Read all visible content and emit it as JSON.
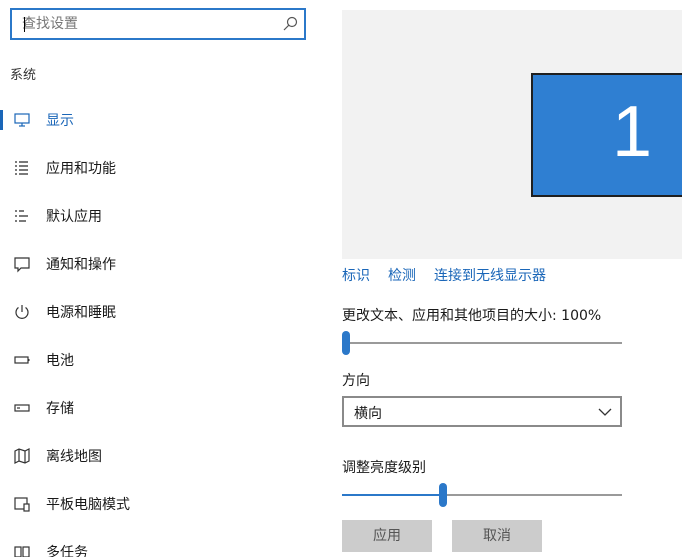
{
  "search": {
    "placeholder": "查找设置",
    "value": ""
  },
  "section": {
    "title": "系统"
  },
  "sidebar": {
    "items": [
      {
        "label": "显示",
        "icon": "monitor-icon",
        "active": true
      },
      {
        "label": "应用和功能",
        "icon": "list-icon"
      },
      {
        "label": "默认应用",
        "icon": "default-apps-icon"
      },
      {
        "label": "通知和操作",
        "icon": "message-icon"
      },
      {
        "label": "电源和睡眠",
        "icon": "power-icon"
      },
      {
        "label": "电池",
        "icon": "battery-icon"
      },
      {
        "label": "存储",
        "icon": "storage-icon"
      },
      {
        "label": "离线地图",
        "icon": "map-icon"
      },
      {
        "label": "平板电脑模式",
        "icon": "tablet-icon"
      },
      {
        "label": "多任务",
        "icon": "multitask-icon"
      }
    ]
  },
  "preview": {
    "monitor_number": "1"
  },
  "links": {
    "identify": "标识",
    "detect": "检测",
    "wireless": "连接到无线显示器"
  },
  "scale": {
    "label": "更改文本、应用和其他项目的大小: 100%",
    "value_fraction": 0.0
  },
  "orientation": {
    "label": "方向",
    "selected": "横向"
  },
  "brightness": {
    "label": "调整亮度级别",
    "value_fraction": 0.36
  },
  "buttons": {
    "apply": "应用",
    "cancel": "取消"
  },
  "colors": {
    "accent": "#2b78c9",
    "monitor": "#2f7fd2",
    "link": "#1a66b8"
  }
}
